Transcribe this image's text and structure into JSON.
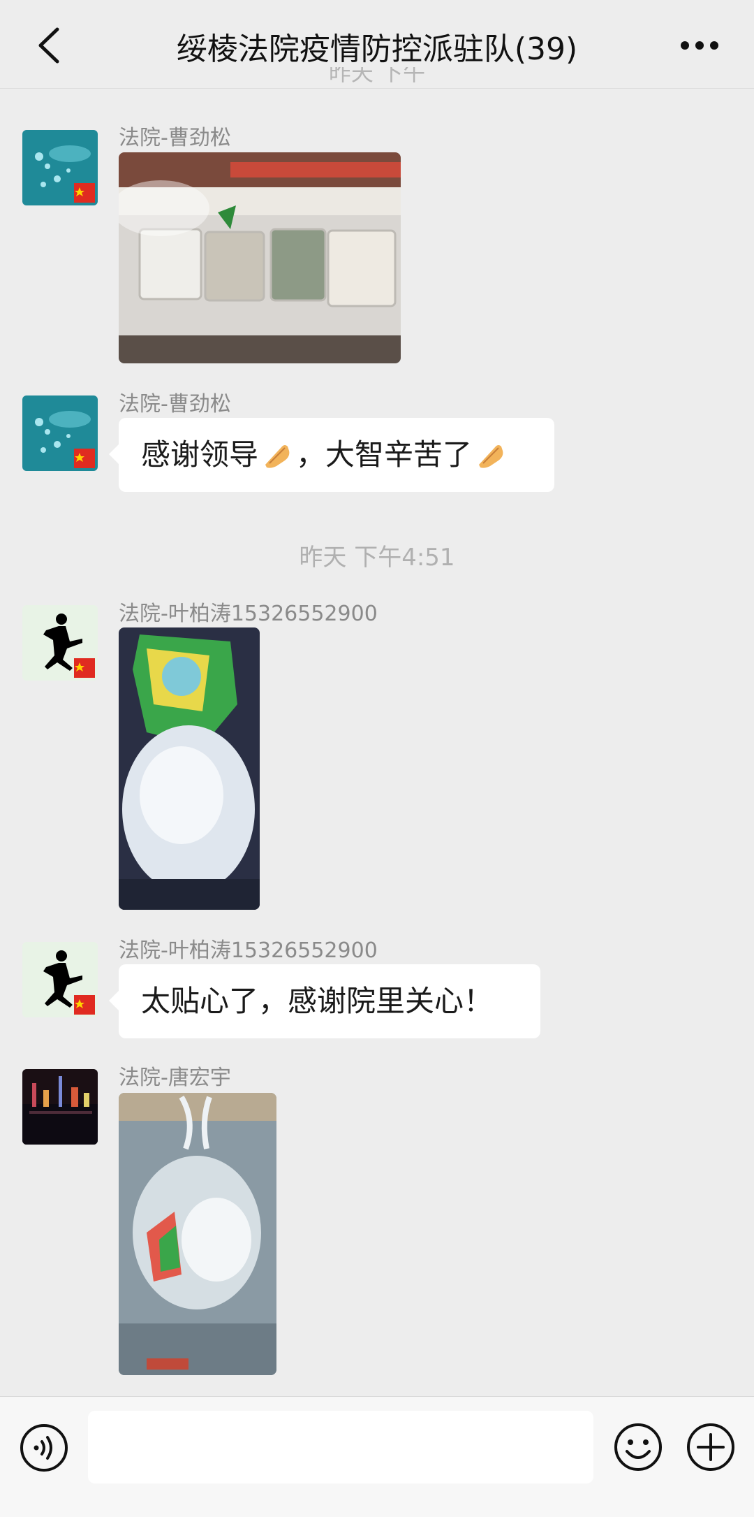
{
  "header": {
    "title": "绥棱法院疫情防控派驻队(39)",
    "partial_timestamp": "昨天 下午"
  },
  "messages": [
    {
      "sender": "法院-曹劲松",
      "type": "image"
    },
    {
      "sender": "法院-曹劲松",
      "type": "text",
      "text_a": "感谢领导",
      "text_b": "，大智辛苦了"
    },
    {
      "timestamp": "昨天 下午4:51"
    },
    {
      "sender": "法院-叶柏涛15326552900",
      "type": "image"
    },
    {
      "sender": "法院-叶柏涛15326552900",
      "type": "text",
      "text": "太贴心了，感谢院里关心！"
    },
    {
      "sender": "法院-唐宏宇",
      "type": "image"
    }
  ],
  "colors": {
    "background": "#ededed",
    "bubble": "#ffffff",
    "sender_text": "#8a8a8a",
    "timestamp_text": "#b0b0b0"
  },
  "icons": {
    "back": "chevron-left-icon",
    "more": "more-dots-icon",
    "voice": "voice-icon",
    "emoji": "smile-icon",
    "plus": "plus-icon",
    "clap": "clap-hands-emoji"
  }
}
